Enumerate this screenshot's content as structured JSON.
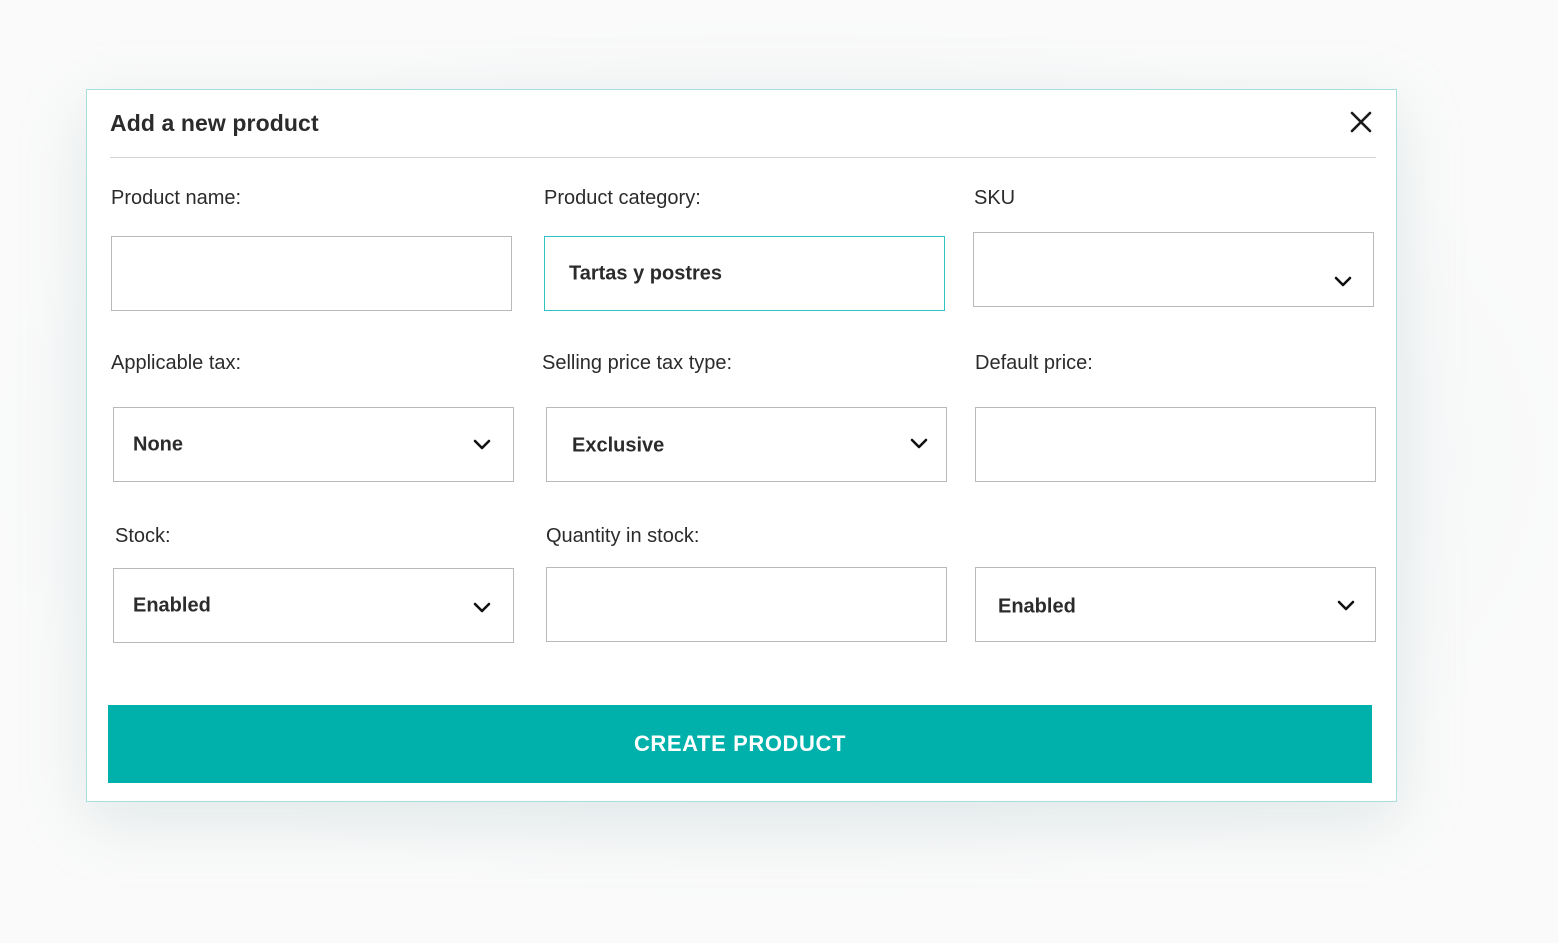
{
  "dialog": {
    "title": "Add a new product",
    "close_icon": "close-icon"
  },
  "form": {
    "product_name": {
      "label": "Product name:",
      "value": ""
    },
    "product_category": {
      "label": "Product category:",
      "value": "Tartas y postres",
      "focused": true
    },
    "sku": {
      "label": "SKU",
      "value": "",
      "icon": "chevron-down-icon"
    },
    "applicable_tax": {
      "label": "Applicable tax:",
      "value": "None",
      "icon": "chevron-down-icon"
    },
    "selling_price_tax_type": {
      "label": "Selling price tax type:",
      "value": "Exclusive",
      "icon": "chevron-down-icon"
    },
    "default_price": {
      "label": "Default price:",
      "value": ""
    },
    "stock": {
      "label": "Stock:",
      "value": "Enabled",
      "icon": "chevron-down-icon"
    },
    "quantity_in_stock": {
      "label": "Quantity in stock:",
      "value": ""
    },
    "extra_select": {
      "value": "Enabled",
      "icon": "chevron-down-icon"
    }
  },
  "actions": {
    "create_label": "CREATE PRODUCT"
  },
  "colors": {
    "accent": "#00b1ab",
    "focus_border": "#2fc4c2",
    "modal_border": "#a9dede",
    "field_border": "#b9b9b9",
    "text": "#2b2b2b"
  }
}
